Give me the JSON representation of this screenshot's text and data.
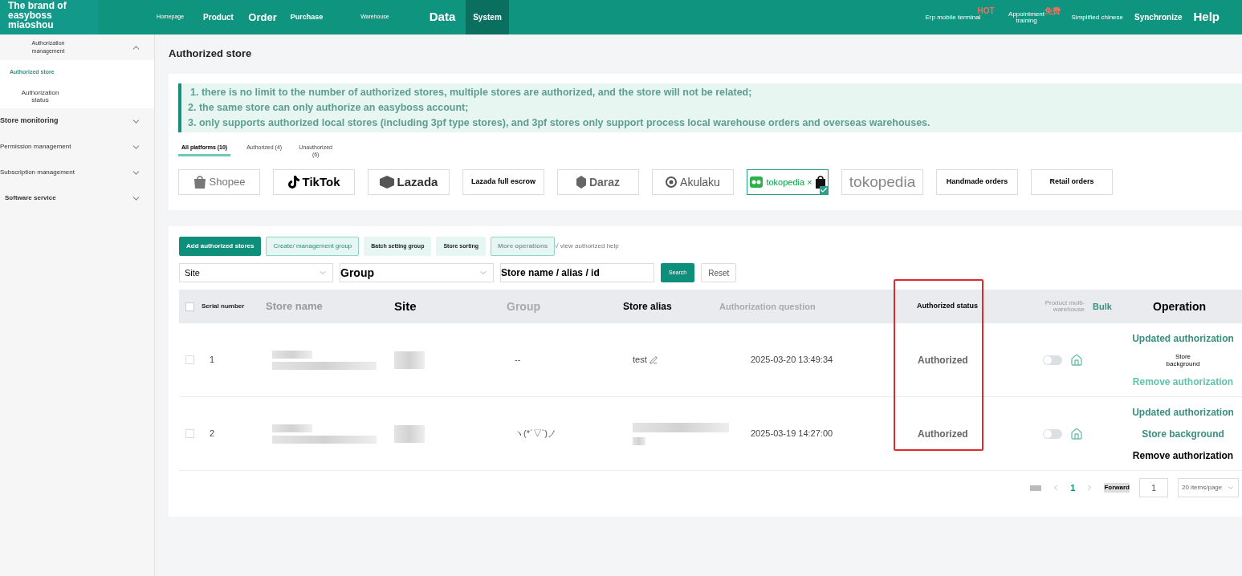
{
  "header": {
    "brand": "The brand of easyboss miaoshou",
    "nav": [
      {
        "label": "Homepage",
        "selected": false
      },
      {
        "label": "Product",
        "selected": false
      },
      {
        "label": "Order",
        "selected": false
      },
      {
        "label": "Purchase",
        "selected": false
      },
      {
        "label": "Warehouse",
        "selected": false
      },
      {
        "label": "Data",
        "selected": false
      },
      {
        "label": "System",
        "selected": true
      }
    ],
    "right": [
      {
        "label": "Erp mobile terminal",
        "badge": "HOT"
      },
      {
        "label": "Appointment training",
        "badge": "免费"
      },
      {
        "label": "Simplified chinese"
      },
      {
        "label": "Synchronize"
      },
      {
        "label": "Help"
      }
    ]
  },
  "sidebar": [
    {
      "label": "Authorization management",
      "expanded": true,
      "children": [
        {
          "label": "Authorized store",
          "selected": true
        },
        {
          "label": "Authorization status",
          "selected": false
        }
      ]
    },
    {
      "label": "Store monitoring",
      "expanded": false
    },
    {
      "label": "Permission management",
      "expanded": false
    },
    {
      "label": "Subscription management",
      "expanded": false
    },
    {
      "label": "Software service",
      "expanded": false
    }
  ],
  "page_title": "Authorized store",
  "notice": [
    "1. there is no limit to the number of authorized stores, multiple stores are authorized, and the store will not be related;",
    "2. the same store can only authorize an easyboss account;",
    "3. only supports authorized local stores (including 3pf type stores), and 3pf stores only support process local warehouse orders and overseas warehouses."
  ],
  "tabs": [
    {
      "label": "All platforms (10)",
      "selected": true
    },
    {
      "label": "Authorized (4)",
      "selected": false
    },
    {
      "label": "Unauthorized (6)",
      "selected": false
    }
  ],
  "platforms": [
    {
      "label": "Shopee",
      "kind": "shopee",
      "selected": false
    },
    {
      "label": "TikTok",
      "kind": "tiktok",
      "selected": false
    },
    {
      "label": "Lazada",
      "kind": "lazada",
      "selected": false
    },
    {
      "label": "Lazada full escrow",
      "kind": "text",
      "selected": false
    },
    {
      "label": "Daraz",
      "kind": "daraz",
      "selected": false
    },
    {
      "label": "Akulaku",
      "kind": "akulaku",
      "selected": false
    },
    {
      "label": "tokopedia ×",
      "kind": "tokoshop",
      "selected": true
    },
    {
      "label": "tokopedia",
      "kind": "toko",
      "selected": false
    },
    {
      "label": "Handmade orders",
      "kind": "text",
      "selected": false
    },
    {
      "label": "Retail orders",
      "kind": "text",
      "selected": false
    }
  ],
  "toolbar": [
    {
      "label": "Add authorized stores",
      "kind": "primary"
    },
    {
      "label": "Create/ management group",
      "kind": "tiny"
    },
    {
      "label": "Batch setting group",
      "kind": "small"
    },
    {
      "label": "Store sorting",
      "kind": "small"
    },
    {
      "label": "More operations",
      "kind": "muted"
    }
  ],
  "help_link": "√ view authorized help",
  "filters": {
    "site": "Site",
    "group": "Group",
    "search_placeholder": "Store name / alias / id",
    "search_button": "Search",
    "reset_button": "Reset"
  },
  "table": {
    "select_all": {
      "checked": false
    },
    "columns": [
      "Serial number",
      "Store name",
      "Site",
      "Group",
      "Store alias",
      "Authorization question",
      "Authorized status",
      "Product multi-warehouse",
      "Bulk",
      "Operation"
    ],
    "rows": [
      {
        "checked": false,
        "serial": "1",
        "group": "--",
        "alias": "test",
        "alias_editable": true,
        "time": "2025-03-20 13:49:34",
        "status": "Authorized",
        "multi_warehouse": {
          "on": false
        },
        "operations": [
          {
            "label": "Updated authorization",
            "kind": "link"
          },
          {
            "label": "Store background",
            "kind": "tiny"
          },
          {
            "label": "Remove authorization",
            "kind": "faded"
          }
        ]
      },
      {
        "checked": false,
        "serial": "2",
        "group": "ヽ(*´▽`)ノ",
        "alias_editable": false,
        "time": "2025-03-19 14:27:00",
        "status": "Authorized",
        "multi_warehouse": {
          "on": false
        },
        "operations": [
          {
            "label": "Updated authorization",
            "kind": "link"
          },
          {
            "label": "Store background",
            "kind": "link"
          },
          {
            "label": "Remove authorization",
            "kind": "plain"
          }
        ]
      }
    ]
  },
  "pagination": {
    "pages": [
      {
        "label": "1",
        "selected": true
      }
    ],
    "forward": "Forward",
    "page_input": "1",
    "page_size": "20 items/page"
  }
}
